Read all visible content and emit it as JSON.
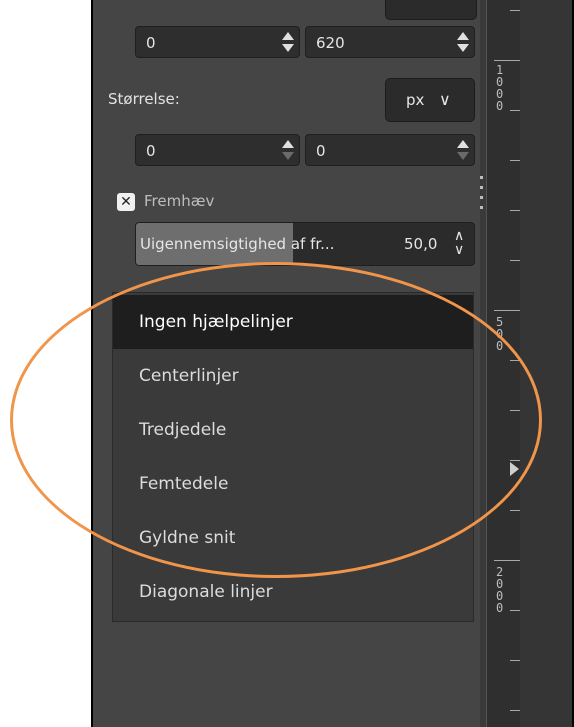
{
  "position": {
    "x_value": "0",
    "y_value": "620"
  },
  "size": {
    "label": "Størrelse:",
    "unit": "px",
    "width_value": "0",
    "height_value": "0"
  },
  "highlight": {
    "label": "Fremhæv",
    "checked": true
  },
  "opacity": {
    "label": "Uigennemsigtighed af fr...",
    "value": "50,0",
    "fraction": 0.5
  },
  "guides_menu": {
    "items": [
      "Ingen hjælpelinjer",
      "Centerlinjer",
      "Tredjedele",
      "Femtedele",
      "Gyldne snit",
      "Diagonale linjer"
    ],
    "selected_index": 0
  },
  "ruler": {
    "labels": [
      "1000",
      "500",
      "2000"
    ]
  },
  "colors": {
    "panel_bg": "#454545",
    "selected_item_bg": "#1e1e1e",
    "annotation_ellipse": "#f0954a"
  }
}
